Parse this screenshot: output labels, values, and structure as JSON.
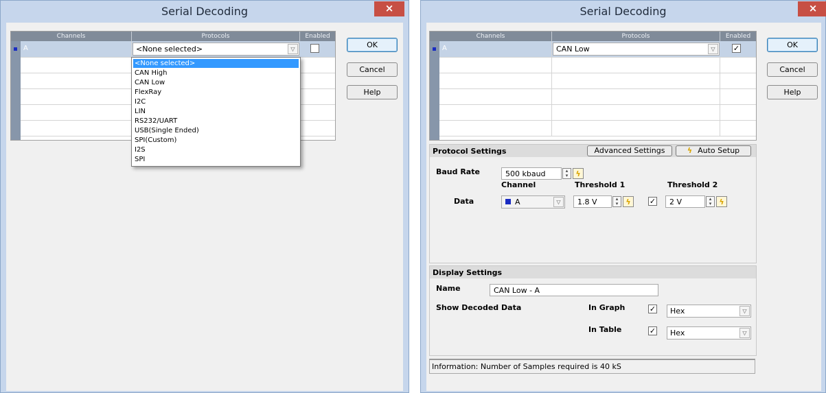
{
  "left_window": {
    "title": "Serial Decoding",
    "close_glyph": "×",
    "headers": {
      "channels": "Channels",
      "protocols": "Protocols",
      "enabled": "Enabled"
    },
    "row": {
      "channel": "A",
      "protocol": "<None selected>",
      "enabled": false
    },
    "dropdown_options": [
      "<None selected>",
      "CAN High",
      "CAN Low",
      "FlexRay",
      "I2C",
      "LIN",
      "RS232/UART",
      "USB(Single Ended)",
      "SPI(Custom)",
      "I2S",
      "SPI"
    ],
    "dropdown_selected": "<None selected>",
    "buttons": {
      "ok": "OK",
      "cancel": "Cancel",
      "help": "Help"
    }
  },
  "right_window": {
    "title": "Serial Decoding",
    "close_glyph": "×",
    "headers": {
      "channels": "Channels",
      "protocols": "Protocols",
      "enabled": "Enabled"
    },
    "row": {
      "channel": "A",
      "protocol": "CAN Low",
      "enabled": true
    },
    "buttons": {
      "ok": "OK",
      "cancel": "Cancel",
      "help": "Help"
    },
    "protocol_settings": {
      "header": "Protocol Settings",
      "advanced_button": "Advanced Settings",
      "auto_setup_button": "Auto Setup",
      "baud_label": "Baud Rate",
      "baud_value": "500 kbaud",
      "col_channel": "Channel",
      "col_threshold1": "Threshold 1",
      "col_threshold2": "Threshold 2",
      "data_label": "Data",
      "channel_value": "A",
      "threshold1_value": "1.8 V",
      "threshold2_enabled": true,
      "threshold2_value": "2 V"
    },
    "display_settings": {
      "header": "Display Settings",
      "name_label": "Name",
      "name_value": "CAN Low - A",
      "show_label": "Show Decoded Data",
      "in_graph_label": "In Graph",
      "in_graph_checked": true,
      "in_graph_format": "Hex",
      "in_table_label": "In Table",
      "in_table_checked": true,
      "in_table_format": "Hex"
    },
    "information": "Information: Number of Samples required is 40 kS"
  },
  "colors": {
    "title_bar": "#c6d6ec",
    "close": "#c74f44",
    "grid_header": "#808b99",
    "selected_item": "#3399ff",
    "channel_blue": "#1a2cc2"
  },
  "icons": {
    "close": "close-icon",
    "dropdown": "chevron-down-icon",
    "spinner": "spinner-icon",
    "auto_setup": "magic-wand-icon"
  }
}
